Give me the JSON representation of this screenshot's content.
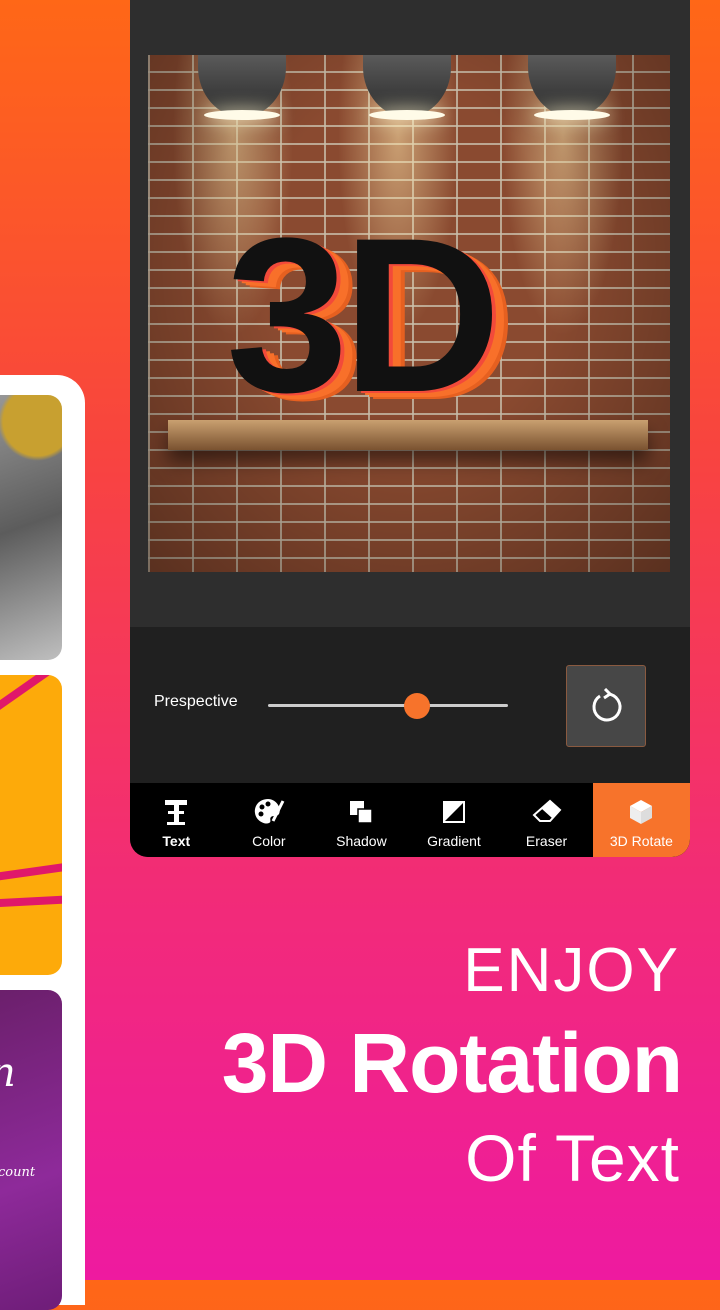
{
  "editor": {
    "preview_text": "3D",
    "perspective": {
      "label": "Prespective",
      "value": 0.62
    },
    "reset_icon": "rotate-ccw-icon",
    "tools": [
      {
        "label": "Text",
        "icon": "text-icon",
        "active": false
      },
      {
        "label": "Color",
        "icon": "palette-icon",
        "active": false
      },
      {
        "label": "Shadow",
        "icon": "shadow-icon",
        "active": false
      },
      {
        "label": "Gradient",
        "icon": "gradient-icon",
        "active": false
      },
      {
        "label": "Eraser",
        "icon": "eraser-icon",
        "active": false
      },
      {
        "label": "3D Rotate",
        "icon": "cube-icon",
        "active": true
      }
    ],
    "accent": "#f7732b"
  },
  "left_preview": {
    "card3_fragment": "n",
    "card3_subtext": "count"
  },
  "headline": {
    "line1": "ENJOY",
    "line2": "3D Rotation",
    "line3": "Of Text"
  }
}
